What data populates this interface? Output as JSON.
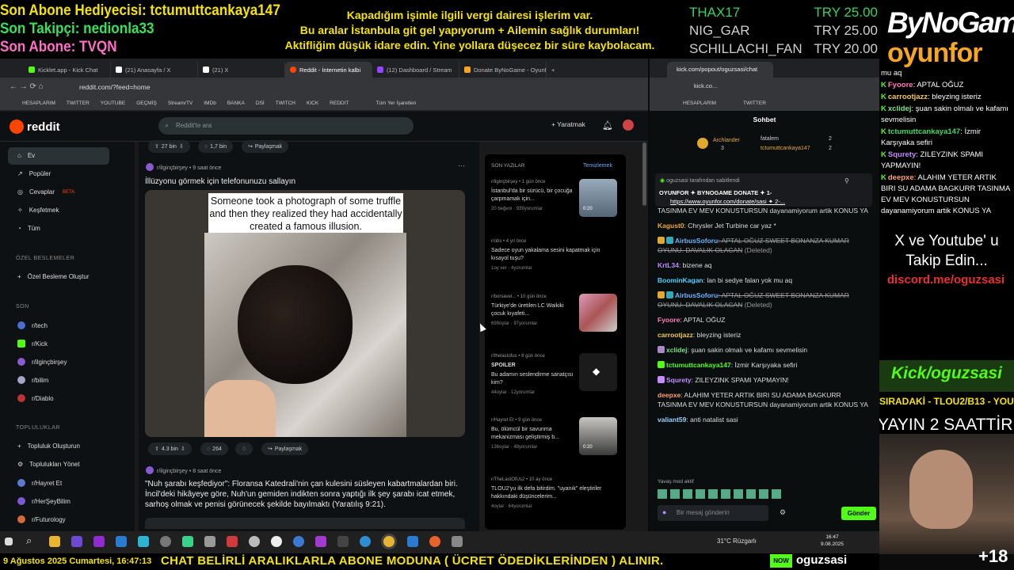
{
  "overlay": {
    "sub_gift": "Son Abone Hediyecisi: tctumuttcankaya147",
    "last_follower": "Son Takipçi: nedionla33",
    "last_sub": "Son Abone: TVQN",
    "notice_line1": "Kapadığım işimle ilgili vergi dairesi işlerim var.",
    "notice_line2": "Bu aralar İstanbula git gel yapıyorum + Ailemin sağlık durumları!",
    "notice_line3": "Aktifliğim düşük idare edin. Yine yollara düşecez bir süre kaybolacam.",
    "donations": [
      {
        "name": "THAX17",
        "amount": "TRY 25.00"
      },
      {
        "name": "NIG_GAR",
        "amount": "TRY 25.00"
      },
      {
        "name": "SCHILLACHI_FAN",
        "amount": "TRY 20.00"
      }
    ],
    "brand_top": "ByNoGame",
    "brand_bottom": "oyunfor",
    "side_chat": [
      {
        "user": "",
        "text": "mu aq"
      },
      {
        "user": "Fyoore",
        "text": ": APTAL OĞUZ"
      },
      {
        "user": "carrootjazz",
        "text": ": bleyzing isteriz"
      },
      {
        "user": "xclidej",
        "text": ": şuan sakin olmalı ve kafamı sevmelisin"
      },
      {
        "user": "tctumuttcankaya147",
        "text": ": İzmir Karşıyaka sefiri"
      },
      {
        "user": "Squrety",
        "text": ": ZILEYZINK SPAMI YAPMAYIN!"
      },
      {
        "user": "deepxe",
        "text": ": ALAHIM YETER ARTIK BIRI SU ADAMA BAGKURR TASINMA EV MEV KONUSTURSUN dayanamiyorum artik KONUS YA"
      }
    ],
    "follow_line1": "X ve Youtube' u",
    "follow_line2": "Takip Edin...",
    "discord": "discord.me/oguzsasi",
    "kick_url": "Kick/oguzsasi",
    "next_up": "SIRADAKİ - TLOU2/B13 - YOUTUBE",
    "stream_time": "YAYIN 2 SAATTİR",
    "viewer_plus": "+18"
  },
  "browser": {
    "tabs": [
      "Kicklet.app - Kick Chat",
      "(21) Anasayfa / X",
      "(21) X",
      "Reddit - İnternetin kalbi",
      "(12) Dashboard / Stream",
      "Donate ByNoGame - Oyunfor"
    ],
    "url": "reddit.com/?feed=home",
    "bookmarks": [
      "HESAPLARIM",
      "TWITTER",
      "YOUTUBE",
      "GEÇMİŞ",
      "StreamrTV",
      "IMDb",
      "BANKA",
      "DSİ",
      "TWITCH",
      "KICK",
      "REDDIT"
    ],
    "all_bookmarks": "Tüm Yer İşaretleri"
  },
  "reddit": {
    "logo": "reddit",
    "search_placeholder": "Reddit'te ara",
    "create_label": "Yaratmak",
    "nav": [
      "Ev",
      "Popüler",
      "Cevaplar",
      "Keşfetmek",
      "Tüm"
    ],
    "beta": "BETA",
    "custom_feeds_header": "ÖZEL BESLEMELER",
    "create_custom_feed": "Özel Besleme Oluştur",
    "recent_header": "SON",
    "recent_subs": [
      "r/tech",
      "r/Kick",
      "r/ilginçbirşey",
      "r/bilim",
      "r/Diablo"
    ],
    "communities_header": "TOPLULUKLAR",
    "create_community": "Topluluk Oluşturun",
    "manage_communities": "Toplulukları Yönet",
    "communities": [
      "r/Hayret Et",
      "r/HerŞeyBilim",
      "r/Futurology"
    ],
    "top_votes": "27 bin",
    "top_comments": "1,7 bin",
    "share": "Paylaşmak",
    "post1": {
      "sub": "r/ilginçbirşey",
      "age": "• 9 saat önce",
      "title": "İllüzyonu görmek için telefonunuzu sallayın",
      "caption": "Someone took a photograph of some truffle and then they realized they had accidentally created a famous illusion.",
      "votes": "4.3 bin",
      "comments": "264"
    },
    "post2": {
      "sub": "r/ilginçbirşey",
      "age": "• 8 saat önce",
      "title": "\"Nuh şarabı keşfediyor\": Floransa Katedrali'nin çan kulesini süsleyen kabartmalardan biri. İncil'deki hikâyeye göre, Nuh'un gemiden indikten sonra yaptığı ilk şey şarabı icat etmek, sarhoş olmak ve penisi görünecek şekilde bayılmaktı (Yaratılış 9:21)."
    },
    "recent_posts_header": "SON YAZILAR",
    "clear": "Temizlemek",
    "recent_posts": [
      {
        "sub": "r/ilginçbirşey",
        "age": "• 1 gün önce",
        "title": "İstanbul'da bir sürücü, bir çocuğa çarpmamak için...",
        "foot": "20 beğeni · 939yorumlar",
        "dur": "0:20"
      },
      {
        "sub": "r/obs",
        "age": "• 4 yıl önce",
        "title": "Sadece oyun yakalama sesini kapatmak için kısayol tuşu?",
        "foot": "1oy ver · 4yorumlar",
        "dur": ""
      },
      {
        "sub": "r/borsavel...",
        "age": "• 10 gün önce",
        "title": "Türkiye'de üretilen LC Waikiki çocuk kıyafeti...",
        "foot": "699oylar · 97yorumlar",
        "dur": "3"
      },
      {
        "sub": "r/thelastofus",
        "age": "• 8 gün önce",
        "title": "Bu adamın seslendirme sanatçısı kim?",
        "foot": "44oylar · 12yorumlar",
        "dur": "",
        "spoiler": "SPOILER"
      },
      {
        "sub": "r/Hayret Et",
        "age": "• 9 gün önce",
        "title": "Bu, ölümcül bir savunma mekanizması geliştirmiş b...",
        "foot": "136oylar · 48yorumlar",
        "dur": "0:20"
      },
      {
        "sub": "r/TheLastOfUs2",
        "age": "• 10 ay önce",
        "title": "TLOU2'yu ilk defa bitirdim. \"uyanık\" eleştiriler hakkındaki düşüncelerim...",
        "foot": "4oylar · 64yorumlar",
        "dur": ""
      }
    ]
  },
  "kick": {
    "tab_title": "kick.com/popout/oguzsasi/chat",
    "url": "kick.co...",
    "bookmarks": [
      "HESAPLARIM",
      "TWITTER"
    ],
    "header": "Sohbet",
    "leader1_name": "Archlander",
    "leader1_count": "3",
    "leader2_name": "fatalem",
    "leader2_count": "2",
    "leader3_name": "tctumuttcankaya147",
    "leader3_count": "2",
    "pinned_by": "oguzsasi tarafından sabitlendi",
    "pinned_title": "OYUNFOR ✦ BYNOGAME DONATE ✦ 1-",
    "pinned_url": "https://www.oyunfor.com/donate/sasi ✦ 2-...",
    "messages": [
      {
        "user": "",
        "text": "TASINMA EV MEV KONUSTURSUN dayanamiyorum artik KONUS YA",
        "color": "#ddd",
        "strike": false
      },
      {
        "user": "Kagust0",
        "text": ": Chrysler Jet Turbine car yaz *",
        "color": "#e6a93c",
        "strike": false
      },
      {
        "user": "AirbusSoforu",
        "text": ": APTAL OĞUZ SWEET BONANZA KUMAR OYUNU. DAVALIK OLACAN",
        "color": "#6fb3ff",
        "strike": true,
        "deleted": "(Deleted)"
      },
      {
        "user": "KrtL34",
        "text": ": bizene aq",
        "color": "#b98bff",
        "strike": false
      },
      {
        "user": "BoominKagan",
        "text": ": lan bi sedye falan yok mu aq",
        "color": "#4bd3ff",
        "strike": false
      },
      {
        "user": "AirbusSoforu",
        "text": ": APTAL OĞUZ SWEET BONANZA KUMAR OYUNU. DAVALIK OLACAN",
        "color": "#6fb3ff",
        "strike": true,
        "deleted": "(Deleted)"
      },
      {
        "user": "Fyoore",
        "text": ": APTAL OĞUZ",
        "color": "#ff7bbd",
        "strike": false
      },
      {
        "user": "carrootjazz",
        "text": ": bleyzing isteriz",
        "color": "#f2c94c",
        "strike": false
      },
      {
        "user": "xclidej",
        "text": ": şuan sakin olmalı ve kafamı sevmelisin",
        "color": "#7be38b",
        "strike": false
      },
      {
        "user": "tctumuttcankaya147",
        "text": ": İzmir Karşıyaka sefiri",
        "color": "#53fc18",
        "strike": false
      },
      {
        "user": "Squrety",
        "text": ": ZILEYZINK SPAMI YAPMAYIN!",
        "color": "#c58bff",
        "strike": false
      },
      {
        "user": "deepxe",
        "text": ": ALAHIM YETER ARTIK BIRI SU ADAMA BAGKURR TASINMA EV MEV KONUSTURSUN dayanamiyorum artik KONUS YA",
        "color": "#ff9f6e",
        "strike": false
      },
      {
        "user": "valiant59",
        "text": ": anti natalist sasi",
        "color": "#9ad0ff",
        "strike": false
      }
    ],
    "slow_mode": "Yavaş mod aktif",
    "input_placeholder": "Bir mesaj gönderin",
    "send": "Gönder"
  },
  "taskbar": {
    "weather": "31°C  Rüzgarlı",
    "time": "16:47",
    "date": "9.08.2025"
  },
  "ticker": {
    "date": "9 Ağustos 2025 Cumartesi, 16:47:13",
    "message": "CHAT BELİRLİ ARALIKLARLA ABONE MODUNA ( ÜCRET ÖDEDİKLERİNDEN ) ALINIR.",
    "kick_badge": "NOW",
    "username": "oguzsasi"
  }
}
